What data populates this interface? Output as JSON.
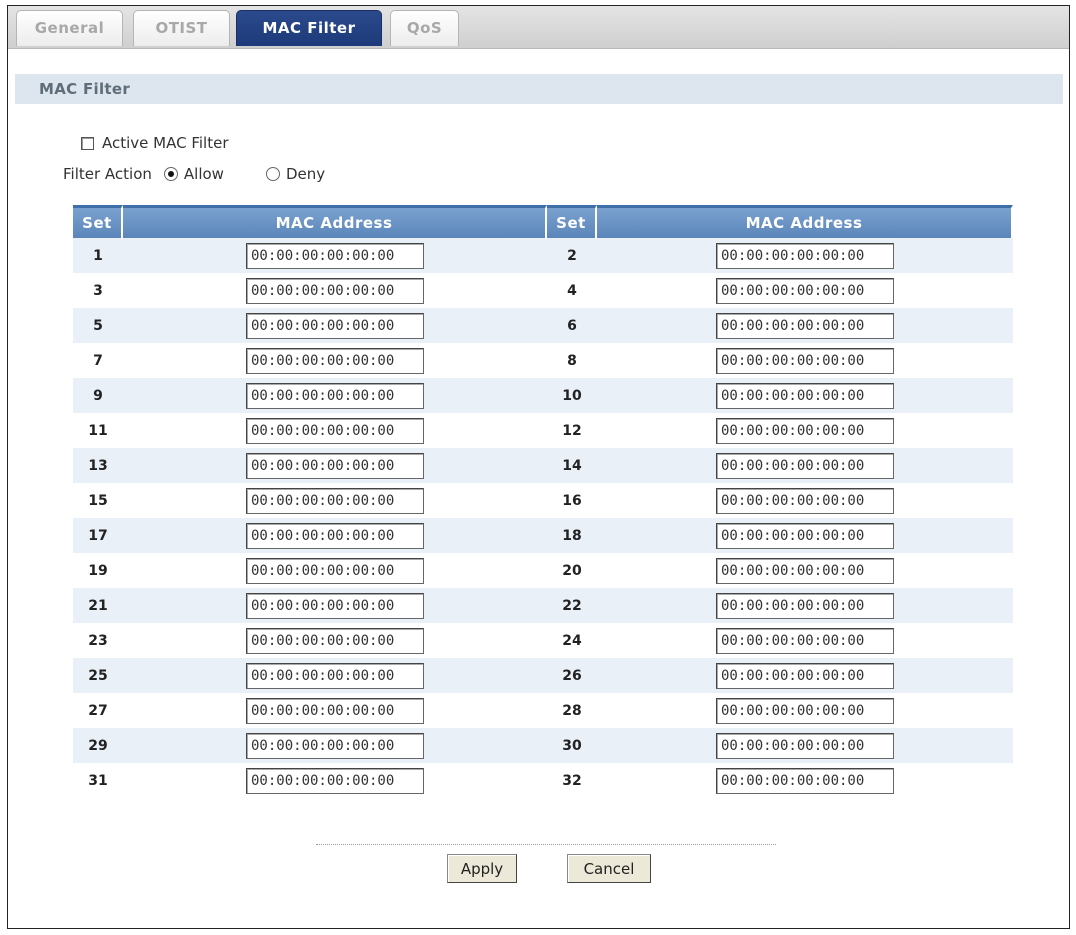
{
  "tabs": [
    {
      "label": "General",
      "active": false
    },
    {
      "label": "OTIST",
      "active": false
    },
    {
      "label": "MAC Filter",
      "active": true
    },
    {
      "label": "QoS",
      "active": false
    }
  ],
  "section": {
    "title": "MAC Filter"
  },
  "active_filter": {
    "label": "Active MAC Filter",
    "checked": false
  },
  "filter_action": {
    "label": "Filter Action",
    "options": [
      {
        "label": "Allow",
        "selected": true
      },
      {
        "label": "Deny",
        "selected": false
      }
    ]
  },
  "table": {
    "headers": [
      "Set",
      "MAC Address",
      "Set",
      "MAC Address"
    ],
    "rows": [
      {
        "left_set": "1",
        "left_mac": "00:00:00:00:00:00",
        "right_set": "2",
        "right_mac": "00:00:00:00:00:00"
      },
      {
        "left_set": "3",
        "left_mac": "00:00:00:00:00:00",
        "right_set": "4",
        "right_mac": "00:00:00:00:00:00"
      },
      {
        "left_set": "5",
        "left_mac": "00:00:00:00:00:00",
        "right_set": "6",
        "right_mac": "00:00:00:00:00:00"
      },
      {
        "left_set": "7",
        "left_mac": "00:00:00:00:00:00",
        "right_set": "8",
        "right_mac": "00:00:00:00:00:00"
      },
      {
        "left_set": "9",
        "left_mac": "00:00:00:00:00:00",
        "right_set": "10",
        "right_mac": "00:00:00:00:00:00"
      },
      {
        "left_set": "11",
        "left_mac": "00:00:00:00:00:00",
        "right_set": "12",
        "right_mac": "00:00:00:00:00:00"
      },
      {
        "left_set": "13",
        "left_mac": "00:00:00:00:00:00",
        "right_set": "14",
        "right_mac": "00:00:00:00:00:00"
      },
      {
        "left_set": "15",
        "left_mac": "00:00:00:00:00:00",
        "right_set": "16",
        "right_mac": "00:00:00:00:00:00"
      },
      {
        "left_set": "17",
        "left_mac": "00:00:00:00:00:00",
        "right_set": "18",
        "right_mac": "00:00:00:00:00:00"
      },
      {
        "left_set": "19",
        "left_mac": "00:00:00:00:00:00",
        "right_set": "20",
        "right_mac": "00:00:00:00:00:00"
      },
      {
        "left_set": "21",
        "left_mac": "00:00:00:00:00:00",
        "right_set": "22",
        "right_mac": "00:00:00:00:00:00"
      },
      {
        "left_set": "23",
        "left_mac": "00:00:00:00:00:00",
        "right_set": "24",
        "right_mac": "00:00:00:00:00:00"
      },
      {
        "left_set": "25",
        "left_mac": "00:00:00:00:00:00",
        "right_set": "26",
        "right_mac": "00:00:00:00:00:00"
      },
      {
        "left_set": "27",
        "left_mac": "00:00:00:00:00:00",
        "right_set": "28",
        "right_mac": "00:00:00:00:00:00"
      },
      {
        "left_set": "29",
        "left_mac": "00:00:00:00:00:00",
        "right_set": "30",
        "right_mac": "00:00:00:00:00:00"
      },
      {
        "left_set": "31",
        "left_mac": "00:00:00:00:00:00",
        "right_set": "32",
        "right_mac": "00:00:00:00:00:00"
      }
    ]
  },
  "buttons": {
    "apply": "Apply",
    "cancel": "Cancel"
  },
  "colors": {
    "active_tab": "#1d3a7a",
    "table_header": "#6a93c5",
    "row_shade": "#eaf0f8",
    "section_header_bg": "#dde6ee"
  }
}
